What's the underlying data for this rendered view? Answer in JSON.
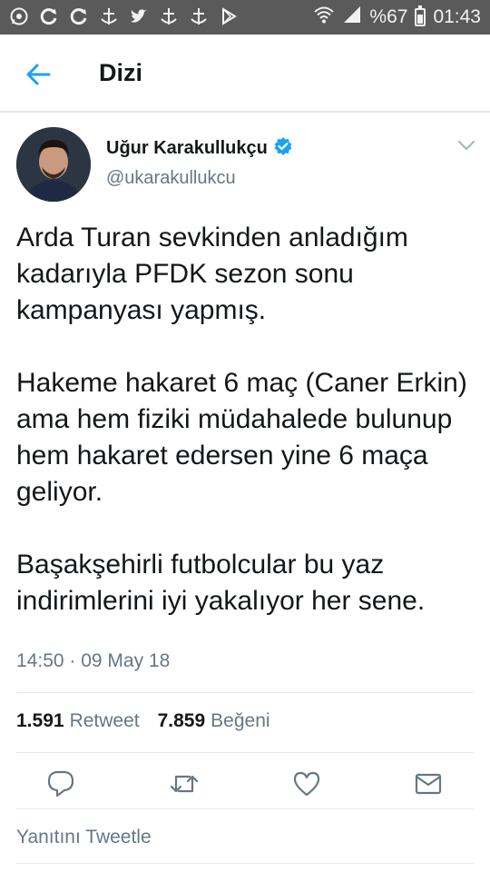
{
  "status_bar": {
    "battery_text": "%67",
    "time": "01:43",
    "left_icons": [
      "whatsapp-icon",
      "refresh-icon",
      "refresh-icon",
      "anchor-icon",
      "twitter-icon",
      "anchor-icon",
      "anchor-icon",
      "play-store-icon"
    ],
    "right_icons": [
      "wifi-icon",
      "signal-icon",
      "battery-icon"
    ]
  },
  "header": {
    "title": "Dizi",
    "back_icon": "arrow-left-icon"
  },
  "author": {
    "name": "Uğur Karakullukçu",
    "handle": "@ukarakullukcu",
    "verified": true
  },
  "tweet": {
    "paragraphs": [
      "Arda Turan sevkinden anladığım kadarıyla PFDK sezon sonu kampanyası yapmış.",
      "Hakeme hakaret 6 maç (Caner Erkin) ama hem fiziki müdahalede bulunup hem hakaret edersen yine 6 maça geliyor.",
      "Başakşehirli futbolcular bu yaz indirimlerini iyi yakalıyor her sene."
    ],
    "timestamp": "14:50 · 09 May 18"
  },
  "stats": {
    "retweet_count": "1.591",
    "retweet_label": "Retweet",
    "like_count": "7.859",
    "like_label": "Beğeni"
  },
  "actions": [
    "reply-icon",
    "retweet-icon",
    "like-icon",
    "message-icon"
  ],
  "reply_placeholder": "Yanıtını Tweetle",
  "colors": {
    "accent": "#1da1f2",
    "text": "#14171a",
    "secondary": "#657786",
    "status_bar": "#5a5a5a"
  }
}
